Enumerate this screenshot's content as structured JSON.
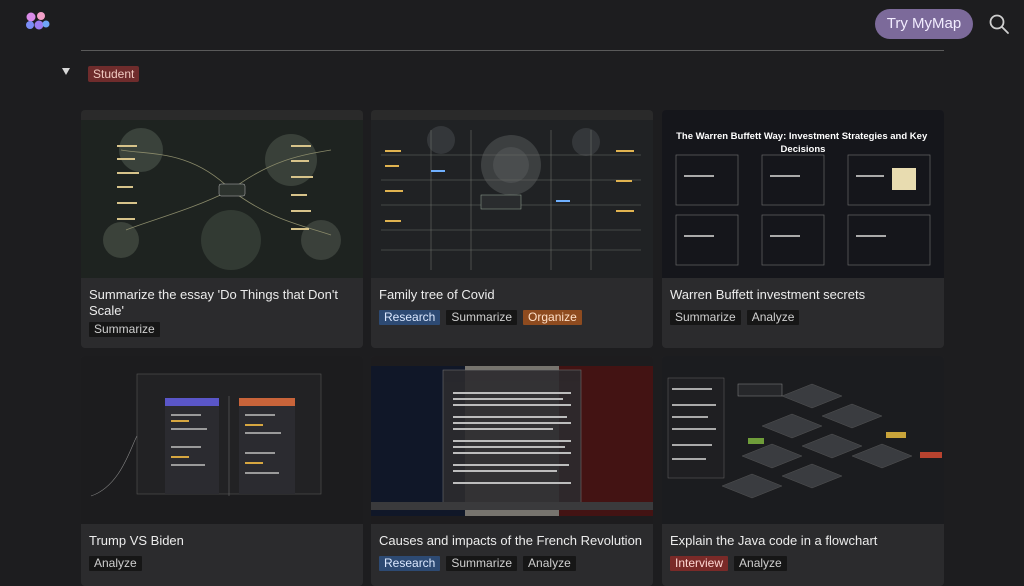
{
  "header": {
    "try_label": "Try MyMap"
  },
  "section": {
    "label": "Student"
  },
  "cards": [
    {
      "title": "Summarize the essay 'Do Things that Don't Scale'",
      "tags": [
        "Summarize"
      ]
    },
    {
      "title": "Family tree of Covid",
      "tags": [
        "Research",
        "Summarize",
        "Organize"
      ]
    },
    {
      "title": "Warren Buffett investment secrets",
      "tags": [
        "Summarize",
        "Analyze"
      ],
      "thumb_title": "The Warren Buffett Way: Investment Strategies and Key Decisions"
    },
    {
      "title": "Trump VS Biden",
      "tags": [
        "Analyze"
      ]
    },
    {
      "title": "Causes and impacts of the French Revolution",
      "tags": [
        "Research",
        "Summarize",
        "Analyze"
      ]
    },
    {
      "title": "Explain the Java code in a flowchart",
      "tags": [
        "Interview",
        "Analyze"
      ]
    }
  ],
  "colors": {
    "accent": "#7c6a9a",
    "research": "#2d4a73",
    "organize": "#8e4b1f",
    "interview": "#7a2a28",
    "student": "#6f2c2c"
  },
  "icons": {
    "logo": "mymap-logo",
    "search": "search-icon",
    "collapse": "caret-down-icon"
  }
}
